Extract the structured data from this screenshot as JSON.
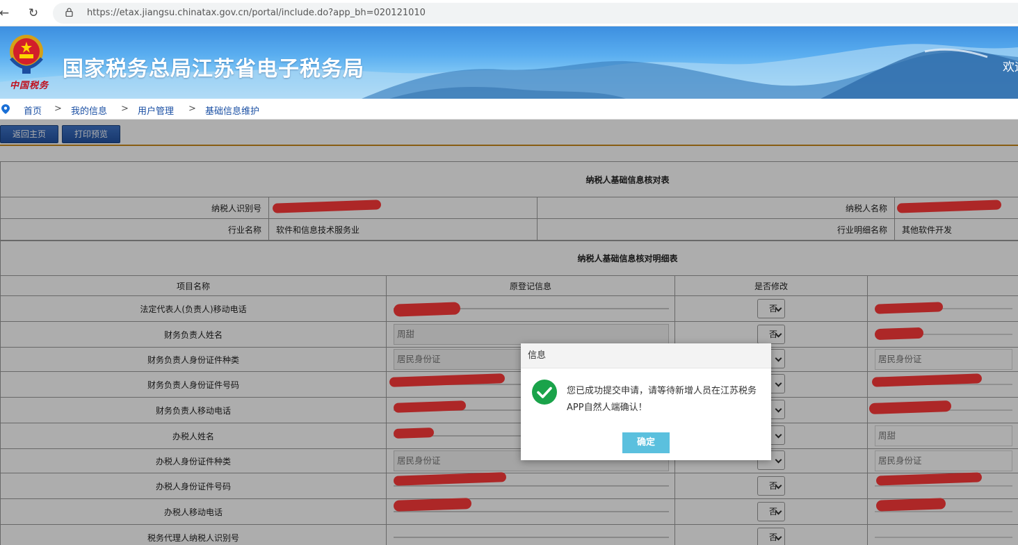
{
  "browser": {
    "url": "https://etax.jiangsu.chinatax.gov.cn/portal/include.do?app_bh=020121010",
    "back_icon": "back-arrow-icon",
    "reload_icon": "reload-icon",
    "lock_icon": "lock-icon"
  },
  "header": {
    "emblem_icon": "national-tax-emblem",
    "emblem_text": "中国税务",
    "title": "国家税务总局江苏省电子税务局",
    "welcome": "欢迎"
  },
  "breadcrumb": {
    "icon": "location-pin-icon",
    "items": [
      "首页",
      "我的信息",
      "用户管理",
      "基础信息维护"
    ],
    "separator": ">"
  },
  "toolbar": {
    "home_label": "返回主页",
    "print_label": "打印预览"
  },
  "summary": {
    "title": "纳税人基础信息核对表",
    "taxpayer_id_label": "纳税人识别号",
    "taxpayer_name_label": "纳税人名称",
    "industry_label": "行业名称",
    "industry_value": "软件和信息技术服务业",
    "industry_detail_label": "行业明细名称",
    "industry_detail_value": "其他软件开发"
  },
  "detail": {
    "title": "纳税人基础信息核对明细表",
    "columns": [
      "项目名称",
      "原登记信息",
      "是否修改",
      ""
    ],
    "rows": [
      {
        "name": "法定代表人(负责人)移动电话",
        "original": "",
        "modify": "否",
        "new": ""
      },
      {
        "name": "财务负责人姓名",
        "original": "周甜",
        "modify": "否",
        "new": ""
      },
      {
        "name": "财务负责人身份证件种类",
        "original": "居民身份证",
        "modify": "",
        "new": "居民身份证"
      },
      {
        "name": "财务负责人身份证件号码",
        "original": "",
        "modify": "",
        "new": ""
      },
      {
        "name": "财务负责人移动电话",
        "original": "",
        "modify": "",
        "new": ""
      },
      {
        "name": "办税人姓名",
        "original": "",
        "modify": "",
        "new": "周甜"
      },
      {
        "name": "办税人身份证件种类",
        "original": "居民身份证",
        "modify": "",
        "new": "居民身份证"
      },
      {
        "name": "办税人身份证件号码",
        "original": "",
        "modify": "否",
        "new": ""
      },
      {
        "name": "办税人移动电话",
        "original": "",
        "modify": "否",
        "new": ""
      },
      {
        "name": "税务代理人纳税人识别号",
        "original": "",
        "modify": "否",
        "new": ""
      }
    ]
  },
  "modal": {
    "title": "信息",
    "icon": "success-check-icon",
    "message": "您已成功提交申请，请等待新增人员在江苏税务APP自然人端确认！",
    "ok_label": "确定"
  },
  "colors": {
    "link": "#1a4fa3",
    "button": "#2d62b8",
    "ok_button": "#5bc0de",
    "success": "#1aa34a",
    "accent_line": "#c98a1b",
    "redaction": "#ff3a3a"
  }
}
